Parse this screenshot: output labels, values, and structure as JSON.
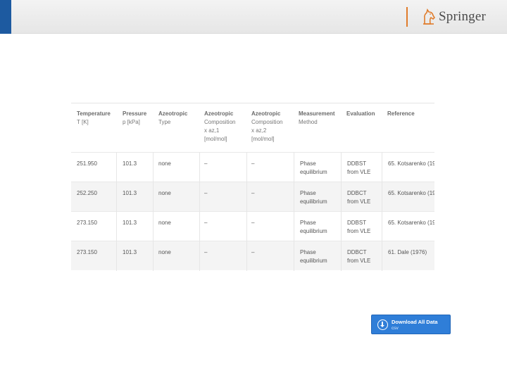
{
  "brand": {
    "name": "Springer",
    "accent_color": "#1d5aa0",
    "separator_color": "#e07b2a",
    "logo_icon": "horse-icon"
  },
  "table": {
    "headers": [
      {
        "title": "Temperature",
        "sub": "T [K]"
      },
      {
        "title": "Pressure",
        "sub": "p [kPa]"
      },
      {
        "title": "Azeotropic",
        "sub": "Type"
      },
      {
        "title": "Azeotropic",
        "sub": "Composition",
        "sub2": "x az,1",
        "sub3": "[mol/mol]"
      },
      {
        "title": "Azeotropic",
        "sub": "Composition",
        "sub2": "x az,2",
        "sub3": "[mol/mol]"
      },
      {
        "title": "Measurement",
        "sub": "Method"
      },
      {
        "title": "Evaluation",
        "sub": ""
      },
      {
        "title": "Reference",
        "sub": ""
      }
    ],
    "rows": [
      {
        "temperature": "251.950",
        "pressure": "101.3",
        "type": "none",
        "comp1": "–",
        "comp2": "–",
        "method1": "Phase",
        "method2": "equilibrium",
        "eval1": "DDBST",
        "eval2": "from VLE",
        "reference": "65. Kotsarenko (19"
      },
      {
        "temperature": "252.250",
        "pressure": "101.3",
        "type": "none",
        "comp1": "–",
        "comp2": "–",
        "method1": "Phase",
        "method2": "equilibrium",
        "eval1": "DDBCT",
        "eval2": "from VLE",
        "reference": "65. Kotsarenko (19"
      },
      {
        "temperature": "273.150",
        "pressure": "101.3",
        "type": "none",
        "comp1": "–",
        "comp2": "–",
        "method1": "Phase",
        "method2": "equilibrium",
        "eval1": "DDBST",
        "eval2": "from VLE",
        "reference": "65. Kotsarenko (19"
      },
      {
        "temperature": "273.150",
        "pressure": "101.3",
        "type": "none",
        "comp1": "–",
        "comp2": "–",
        "method1": "Phase",
        "method2": "equilibrium",
        "eval1": "DDBCT",
        "eval2": "from VLE",
        "reference": "61. Dale (1976)"
      }
    ]
  },
  "download": {
    "label": "Download All Data",
    "sub": "csv",
    "icon": "download-icon",
    "color": "#2f7ed8"
  }
}
